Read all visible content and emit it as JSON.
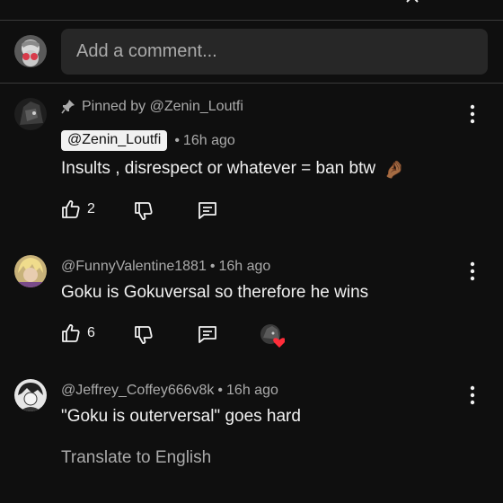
{
  "icons": {
    "chevron": "chevron-up-icon",
    "pin": "pin-icon",
    "like": "thumbs-up-icon",
    "dislike": "thumbs-down-icon",
    "reply": "reply-icon",
    "more": "more-vert-icon",
    "creator_heart": "creator-heart-icon"
  },
  "composer": {
    "placeholder": "Add a comment..."
  },
  "comments": [
    {
      "pinned_label": "Pinned by @Zenin_Loutfi",
      "author": "@Zenin_Loutfi",
      "time": "16h ago",
      "text": "Insults , disrespect or whatever = ban btw",
      "emoji": "🤌🏾",
      "likes": "2"
    },
    {
      "author": "@FunnyValentine1881",
      "time": "16h ago",
      "text": "Goku is Gokuversal so therefore he wins",
      "likes": "6"
    },
    {
      "author": "@Jeffrey_Coffey666v8k",
      "time": "16h ago",
      "text": "\"Goku is outerversal\" goes hard",
      "translate_label": "Translate to English"
    }
  ],
  "colors": {
    "background": "#0f0f0f",
    "text_primary": "#f1f1f1",
    "text_secondary": "#aaaaaa",
    "input_bg": "#272727",
    "heart": "#ff2d3a"
  }
}
